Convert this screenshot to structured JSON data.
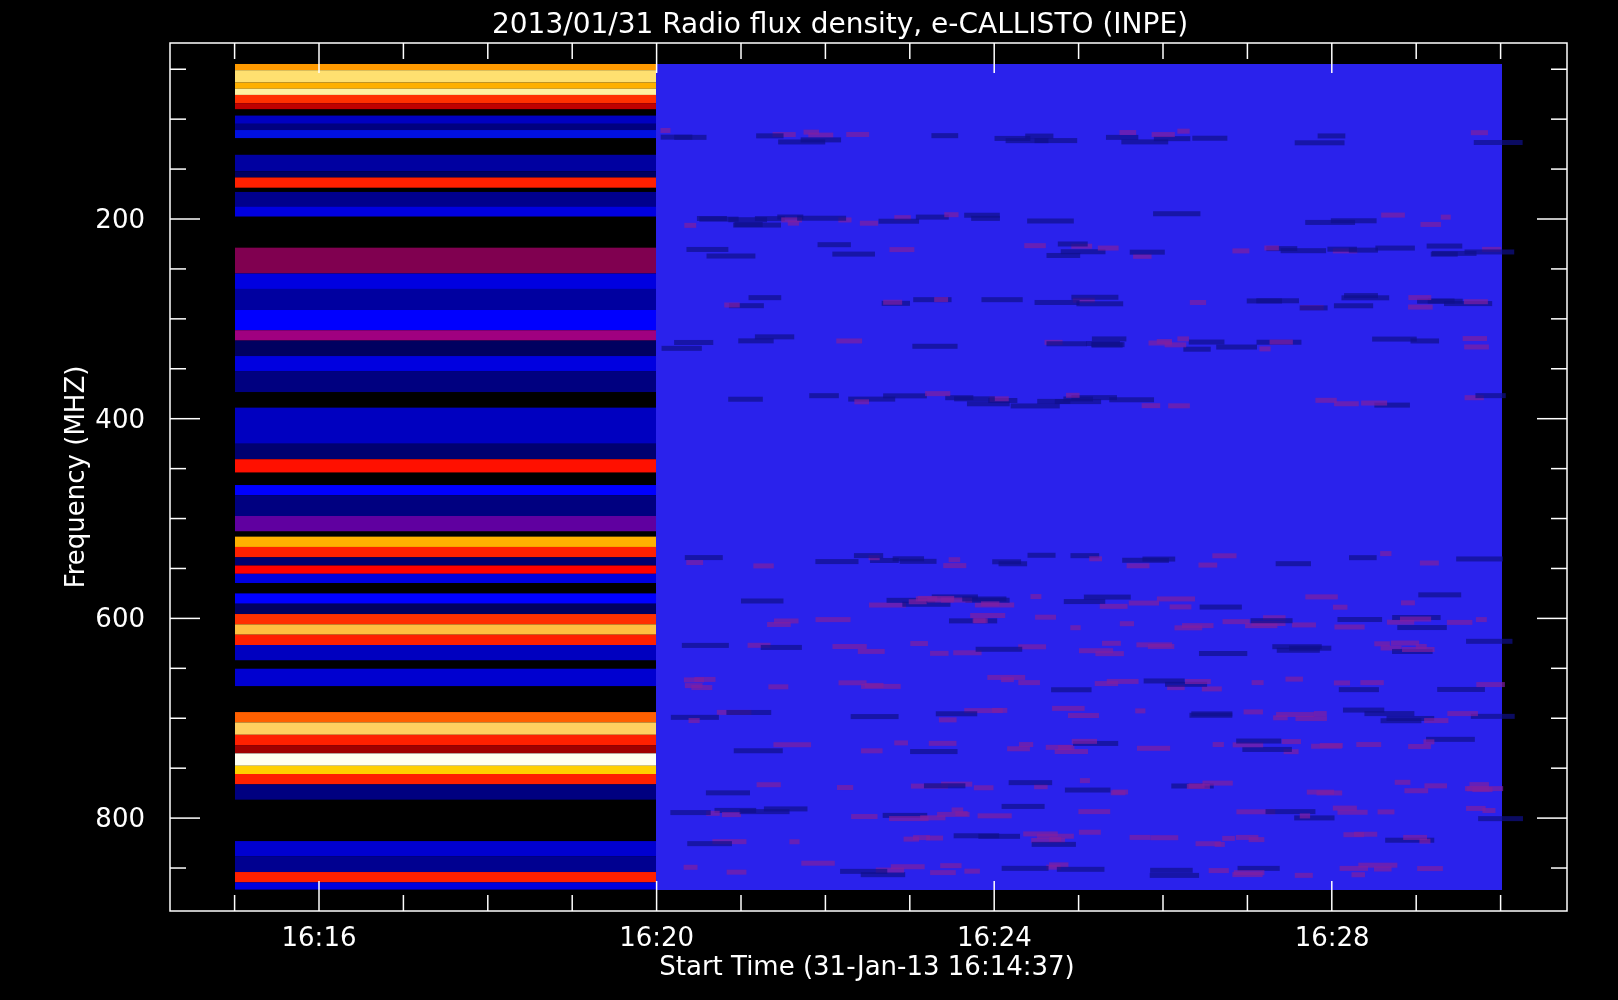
{
  "plot": {
    "title": "2013/01/31  Radio flux density, e-CALLISTO (INPE)",
    "xlabel": "Start Time (31-Jan-13 16:14:37)",
    "ylabel": "Frequency (MHZ)",
    "xtick_labels": [
      "16:16",
      "16:20",
      "16:24",
      "16:28"
    ],
    "ytick_labels": [
      "200",
      "400",
      "600",
      "800"
    ]
  }
}
